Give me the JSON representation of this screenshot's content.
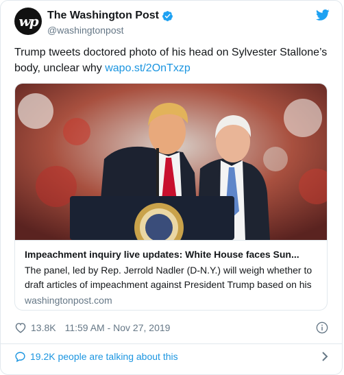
{
  "account": {
    "display_name": "The Washington Post",
    "handle": "@washingtonpost",
    "avatar_text": "wp",
    "verified": true
  },
  "tweet": {
    "text_before_link": "Trump tweets doctored photo of his head on Sylvester Stallone’s body, unclear why ",
    "link_text": "wapo.st/2OnTxzp"
  },
  "card": {
    "image_alt": "Trump and Pence on stage at a rally",
    "title": "Impeachment inquiry live updates: White House faces Sun...",
    "description": "The panel, led by Rep. Jerrold Nadler (D-N.Y.) will weigh whether to draft articles of impeachment against President Trump based on his",
    "domain": "washingtonpost.com"
  },
  "meta": {
    "likes": "13.8K",
    "timestamp": "11:59 AM - Nov 27, 2019"
  },
  "conversation": {
    "label": "19.2K people are talking about this"
  },
  "icons": {
    "verified": "verified-badge-icon",
    "brand": "twitter-bird-icon",
    "like": "heart-icon",
    "info": "info-icon",
    "conversation": "speech-bubble-icon",
    "chevron": "chevron-right-icon"
  },
  "colors": {
    "link": "#1b95e0",
    "text": "#14171a",
    "muted": "#657786",
    "border": "#e1e8ed"
  }
}
